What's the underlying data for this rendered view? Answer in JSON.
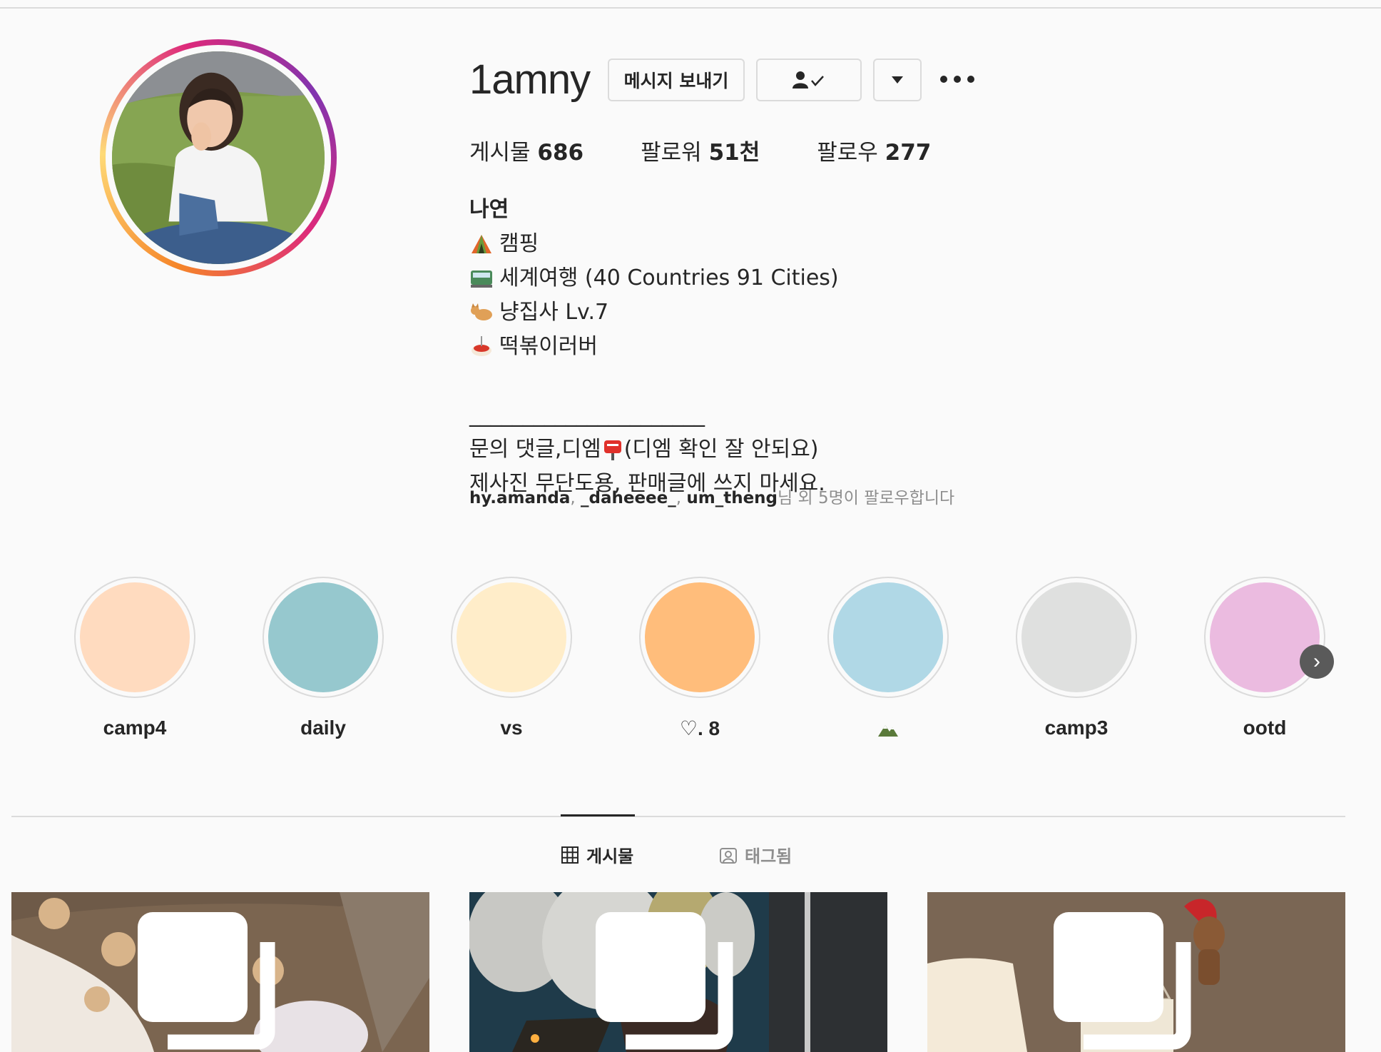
{
  "profile": {
    "username": "1amny",
    "buttons": {
      "message": "메시지 보내기"
    },
    "stats": {
      "posts_label": "게시물",
      "posts_value": "686",
      "followers_label": "팔로워",
      "followers_value": "51천",
      "following_label": "팔로우",
      "following_value": "277"
    },
    "bio": {
      "name": "나연",
      "line1": "캠핑",
      "line2": "세계여행 (40 Countries 91 Cities)",
      "line3": "냥집사 Lv.7",
      "line4": "떡볶이러버",
      "line5": "______________________",
      "line6_a": "문의 댓글,디엠",
      "line6_b": "(디엠 확인 잘 안되요)",
      "line7": "제사진 무단도용, 판매글에 쓰지 마세요."
    },
    "followed_by": {
      "user1": "hy.amanda",
      "user2": "_daheeee_",
      "user3": "um_theng",
      "sep": ", ",
      "suffix": "님 외 5명이 팔로우합니다"
    }
  },
  "highlights": [
    {
      "label": "camp4",
      "color": "#ffdbbf"
    },
    {
      "label": "daily",
      "color": "#96c8ce"
    },
    {
      "label": "vs",
      "color": "#ffedc9"
    },
    {
      "label": "♡. 8",
      "color": "#ffbd7b"
    },
    {
      "label": "",
      "color": "#b0d8e6"
    },
    {
      "label": "camp3",
      "color": "#dfe0df"
    },
    {
      "label": "ootd",
      "color": "#ebbbe0"
    }
  ],
  "tabs": {
    "posts": "게시물",
    "tagged": "태그됨"
  }
}
